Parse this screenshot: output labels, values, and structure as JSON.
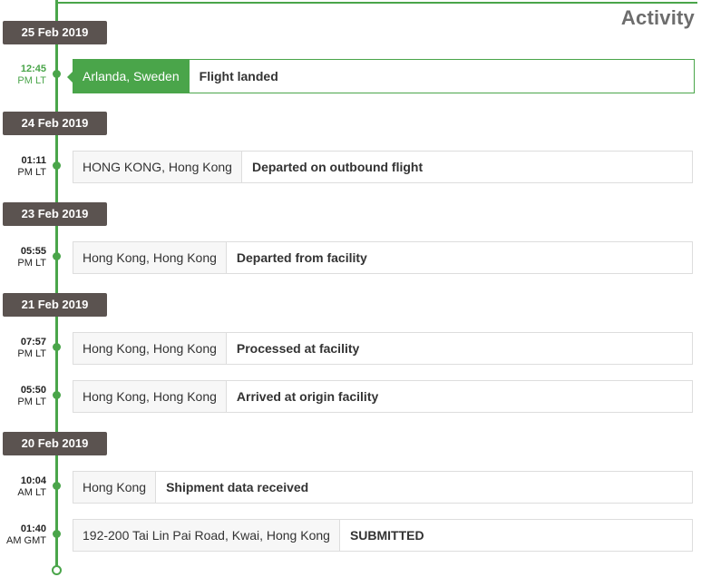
{
  "header": {
    "title": "Activity"
  },
  "colors": {
    "accent": "#4aa54a",
    "date_badge": "#5b5350"
  },
  "groups": [
    {
      "date": "25 Feb 2019",
      "events": [
        {
          "time": "12:45",
          "zone": "PM LT",
          "location": "Arlanda, Sweden",
          "status": "Flight landed",
          "active": true
        }
      ]
    },
    {
      "date": "24 Feb 2019",
      "events": [
        {
          "time": "01:11",
          "zone": "PM LT",
          "location": "HONG KONG, Hong Kong",
          "status": "Departed on outbound flight",
          "active": false
        }
      ]
    },
    {
      "date": "23 Feb 2019",
      "events": [
        {
          "time": "05:55",
          "zone": "PM LT",
          "location": "Hong Kong, Hong Kong",
          "status": "Departed from facility",
          "active": false
        }
      ]
    },
    {
      "date": "21 Feb 2019",
      "events": [
        {
          "time": "07:57",
          "zone": "PM LT",
          "location": "Hong Kong, Hong Kong",
          "status": "Processed at facility",
          "active": false
        },
        {
          "time": "05:50",
          "zone": "PM LT",
          "location": "Hong Kong, Hong Kong",
          "status": "Arrived at origin facility",
          "active": false
        }
      ]
    },
    {
      "date": "20 Feb 2019",
      "events": [
        {
          "time": "10:04",
          "zone": "AM LT",
          "location": "Hong Kong",
          "status": "Shipment data received",
          "active": false
        },
        {
          "time": "01:40",
          "zone": "AM GMT",
          "location": "192-200 Tai Lin Pai Road, Kwai, Hong Kong",
          "status": "SUBMITTED",
          "active": false
        }
      ]
    }
  ]
}
